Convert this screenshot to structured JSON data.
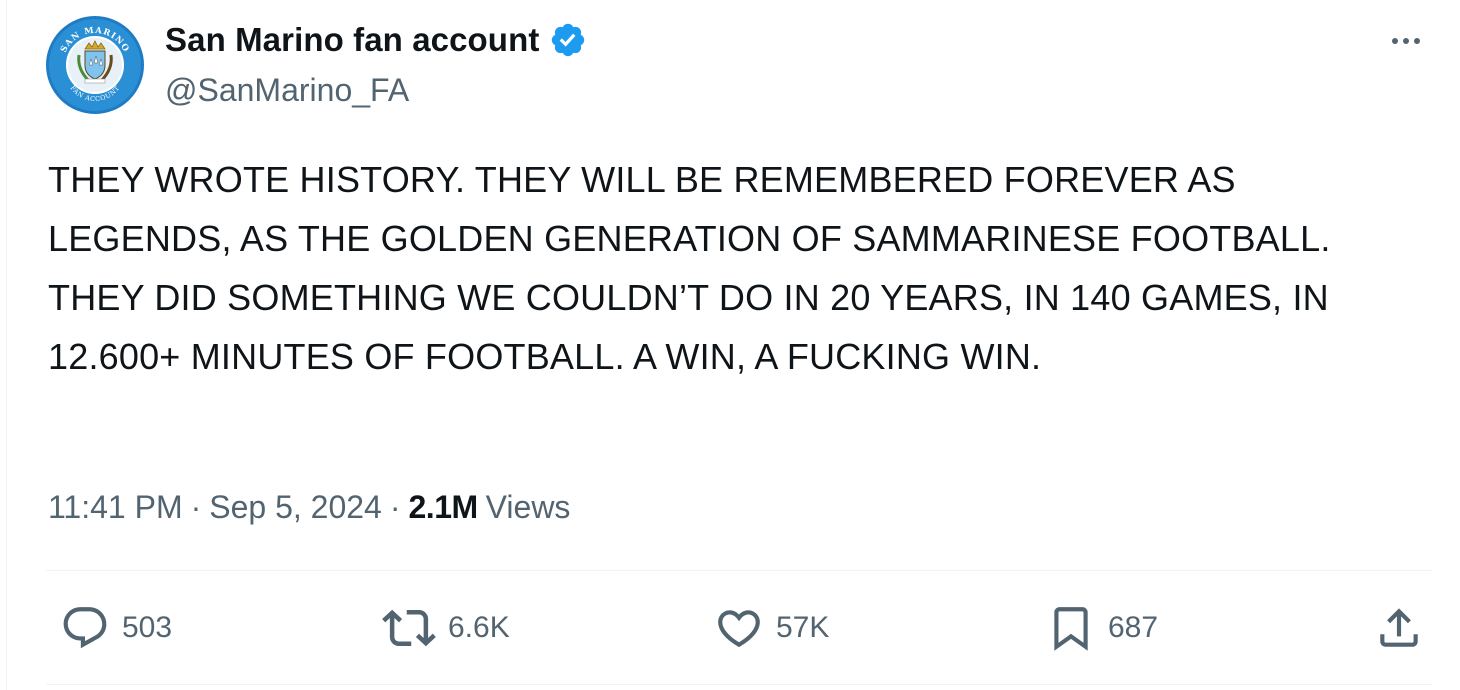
{
  "author": {
    "display_name": "San Marino fan account",
    "handle": "@SanMarino_FA",
    "verified": true,
    "avatar_icon": "san-marino-crest-icon",
    "avatar_text_top": "SAN MARINO",
    "avatar_text_bottom": "FAN ACCOUNT"
  },
  "tweet": {
    "text": "THEY WROTE HISTORY. THEY WILL BE REMEMBERED FOREVER AS LEGENDS, AS THE GOLDEN GENERATION OF SAMMARINESE FOOTBALL. THEY DID SOMETHING WE COULDN’T DO IN 20 YEARS, IN 140 GAMES, IN 12.600+ MINUTES OF FOOTBALL. A WIN, A FUCKING WIN.",
    "time": "11:41 PM",
    "date": "Sep 5, 2024",
    "separator": "·",
    "views_count": "2.1M",
    "views_label": "Views"
  },
  "actions": {
    "replies": "503",
    "retweets": "6.6K",
    "likes": "57K",
    "bookmarks": "687"
  },
  "colors": {
    "text_primary": "#0f1419",
    "text_secondary": "#536471",
    "verified_blue": "#1d9bf0",
    "avatar_blue": "#2b8fd6",
    "divider": "#eff3f4"
  }
}
